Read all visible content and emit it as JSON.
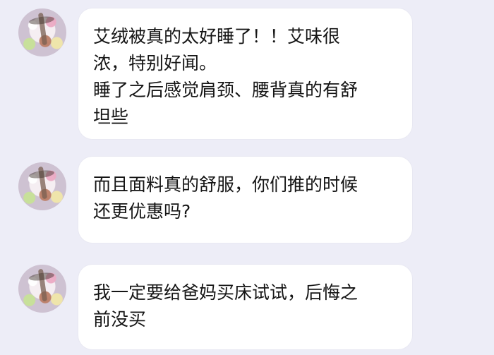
{
  "chat": {
    "messages": [
      {
        "avatar": "user-avatar-icon",
        "text": "艾绒被真的太好睡了！！艾味很\n浓，特别好闻。\n睡了之后感觉肩颈、腰背真的有舒\n坦些"
      },
      {
        "avatar": "user-avatar-icon",
        "text": "而且面料真的舒服，你们推的时候\n还更优惠吗?"
      },
      {
        "avatar": "user-avatar-icon",
        "text": "我一定要给爸妈买床试试，后悔之\n前没买"
      }
    ]
  }
}
